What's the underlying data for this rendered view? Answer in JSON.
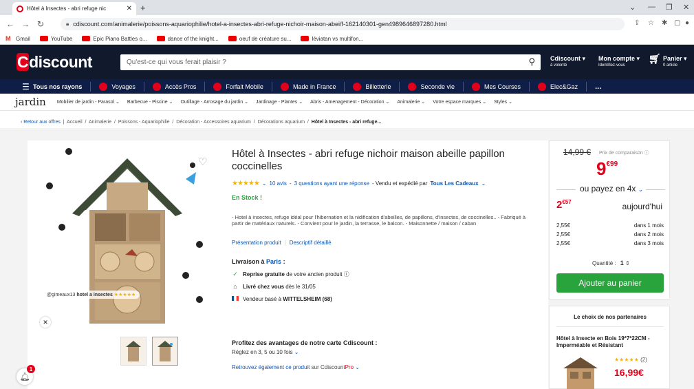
{
  "browser": {
    "tab_title": "Hôtel à Insectes - abri refuge nic",
    "url": "cdiscount.com/animalerie/poissons-aquariophilie/hotel-a-insectes-abri-refuge-nichoir-maison-abei/f-162140301-gen4989646897280.html",
    "bookmarks": [
      {
        "label": "Gmail"
      },
      {
        "label": "YouTube"
      },
      {
        "label": "Epic Piano Battles o..."
      },
      {
        "label": "dance of the knight..."
      },
      {
        "label": "oeuf de créature su..."
      },
      {
        "label": "léviatan vs multifon..."
      }
    ]
  },
  "header": {
    "logo": "discount",
    "logo_c": "C",
    "search_placeholder": "Qu'est-ce qui vous ferait plaisir ?",
    "volonte": "Cdiscount",
    "volonte_sub": "à volonté",
    "account": "Mon compte",
    "account_sub": "Identifiez-vous",
    "cart": "Panier",
    "cart_sub": "0 article"
  },
  "menu": [
    "Tous nos rayons",
    "Voyages",
    "Accès Pros",
    "Forfait Mobile",
    "Made in France",
    "Billetterie",
    "Seconde vie",
    "Mes Courses",
    "Elec&Gaz",
    "..."
  ],
  "category": {
    "title": "jardin",
    "items": [
      "Mobilier de jardin - Parasol",
      "Barbecue - Piscine",
      "Outillage - Arrosage du jardin",
      "Jardinage - Plantes",
      "Abris - Amenagement - Décoration",
      "Animalerie",
      "Votre espace marques",
      "Styles"
    ]
  },
  "breadcrumb": {
    "back": "Retour aux offres",
    "items": [
      "Accueil",
      "Animalerie",
      "Poissons - Aquariophilie",
      "Décoration - Accessoires aquarium",
      "Décorations aquarium"
    ],
    "current": "Hôtel à Insectes - abri refuge..."
  },
  "product": {
    "image_tag_user": "@gimeaux13",
    "image_tag_text": "hotel a insectes",
    "title": "Hôtel à Insectes - abri refuge nichoir maison abeille papillon coccinelles",
    "reviews": "10 avis",
    "questions": "3 questions ayant une réponse",
    "sold_by": "- Vendu et expédié par",
    "seller": "Tous Les Cadeaux",
    "stock": "En Stock !",
    "description": "- Hotel à insectes, refuge idéal pour l'hibernation et la nidification d'abeilles, de papillons, d'insectes, de coccinelles.. - Fabriqué à partir de matériaux naturels. - Convient pour le jardin, la terrasse, le balcon. - Maisonnette / maison / caban",
    "link_presentation": "Présentation produit",
    "link_desc": "Descriptif détaillé",
    "delivery_label": "Livraison à",
    "delivery_city": "Paris",
    "reprise_bold": "Reprise gratuite",
    "reprise_rest": "de votre ancien produit",
    "livre_bold": "Livré chez vous",
    "livre_rest": "dès le 31/05",
    "vendeur_rest": "Vendeur basé à",
    "vendeur_bold": "WITTELSHEIM (68)",
    "promo_title": "Profitez des avantages de notre carte Cdiscount :",
    "promo_sub": "Réglez en 3, 5 ou 10 fois",
    "promo_link": "Retrouvez également ce produit",
    "promo_link2": "sur Cdiscount",
    "promo_pro": "Pro"
  },
  "price": {
    "old": "14,99 €",
    "compare": "Prix de comparaison",
    "big_int": "9",
    "big_dec": "€99",
    "or_pay": "ou payez en 4x",
    "first_int": "2",
    "first_dec": "€57",
    "first_label": "aujourd'hui",
    "installments": [
      {
        "amount": "2,55€",
        "when": "dans 1 mois"
      },
      {
        "amount": "2,55€",
        "when": "dans 2 mois"
      },
      {
        "amount": "2,55€",
        "when": "dans 3 mois"
      }
    ],
    "qty_label": "Quantité :",
    "qty_value": "1",
    "add_to_cart": "Ajouter au panier"
  },
  "partners": {
    "heading": "Le choix de nos partenaires",
    "title": "Hôtel à Insecte en Bois 19*7*22CM - Imperméable et Résistant",
    "reviews": "(2)",
    "price": "16,99€"
  },
  "notifications": {
    "count": "1"
  },
  "colors": {
    "brand_red": "#e2001a",
    "header_navy": "#11192c",
    "menu_navy": "#0f1e46",
    "green": "#29a33c",
    "link_blue": "#0d55b3"
  }
}
